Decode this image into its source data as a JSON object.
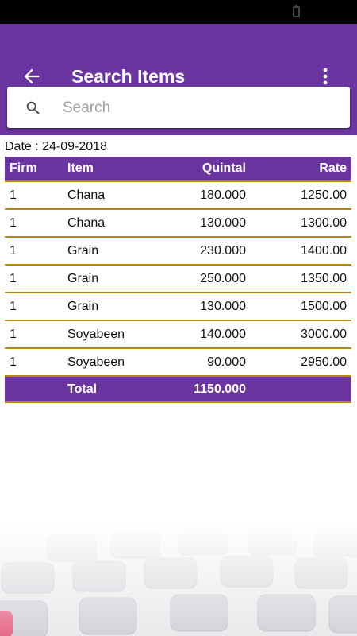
{
  "app": {
    "title": "Search Items"
  },
  "search": {
    "placeholder": "Search",
    "value": ""
  },
  "date_label": "Date : 24-09-2018",
  "table": {
    "columns": [
      "Firm",
      "Item",
      "Quintal",
      "Rate"
    ],
    "rows": [
      [
        "1",
        "Chana",
        "180.000",
        "1250.00"
      ],
      [
        "1",
        "Chana",
        "130.000",
        "1300.00"
      ],
      [
        "1",
        "Grain",
        "230.000",
        "1400.00"
      ],
      [
        "1",
        "Grain",
        "250.000",
        "1350.00"
      ],
      [
        "1",
        "Grain",
        "130.000",
        "1500.00"
      ],
      [
        "1",
        "Soyabeen",
        "140.000",
        "3000.00"
      ],
      [
        "1",
        "Soyabeen",
        "90.000",
        "2950.00"
      ]
    ],
    "total": {
      "label": "Total",
      "quintal": "1150.000"
    }
  },
  "colors": {
    "primary": "#6a35a0",
    "divider": "#b8860b"
  },
  "icons": {
    "back": "arrow-left-icon",
    "menu": "more-vertical-icon",
    "search": "search-icon",
    "battery": "battery-icon"
  }
}
